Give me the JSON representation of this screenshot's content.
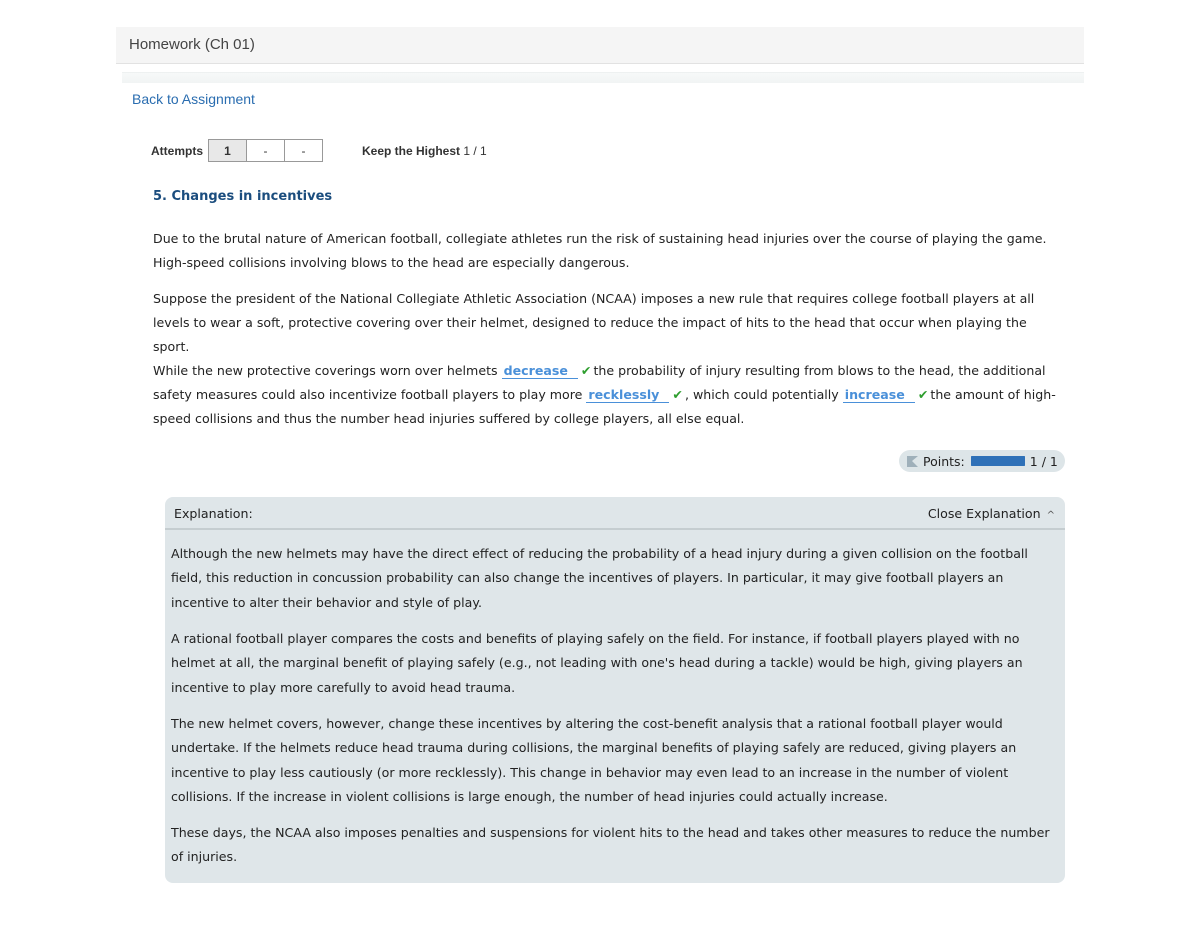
{
  "header": {
    "title": "Homework (Ch 01)"
  },
  "nav": {
    "back_link": "Back to Assignment"
  },
  "attempts": {
    "label": "Attempts",
    "boxes": [
      "1",
      "-",
      "-"
    ],
    "keep_label": "Keep the Highest",
    "keep_value": "1 / 1"
  },
  "question": {
    "title": "5. Changes in incentives",
    "para1": "Due to the brutal nature of American football, collegiate athletes run the risk of sustaining head injuries over the course of playing the game. High-speed collisions involving blows to the head are especially dangerous.",
    "para2": "Suppose the president of the National Collegiate Athletic Association (NCAA) imposes a new rule that requires college football players at all levels to wear a soft, protective covering over their helmet, designed to reduce the impact of hits to the head that occur when playing the sport.",
    "para3": {
      "part1": "While the new protective coverings worn over helmets",
      "blank1": "decrease",
      "part2": "the probability of injury resulting from blows to the head, the additional safety measures could also incentivize football players to play more",
      "blank2": "recklessly",
      "part3": ", which could potentially",
      "blank3": "increase",
      "part4": "the amount of high-speed collisions and thus the number head injuries suffered by college players, all else equal."
    },
    "check_glyph": "✔"
  },
  "points": {
    "label": "Points:",
    "value": "1 / 1",
    "fraction": 1.0
  },
  "explanation": {
    "title": "Explanation:",
    "close_label": "Close Explanation",
    "chevron": "^",
    "paragraphs": [
      "Although the new helmets may have the direct effect of reducing the probability of a head injury during a given collision on the football field, this reduction in concussion probability can also change the incentives of players. In particular, it may give football players an incentive to alter their behavior and style of play.",
      "A rational football player compares the costs and benefits of playing safely on the field. For instance, if football players played with no helmet at all, the marginal benefit of playing safely (e.g., not leading with one's head during a tackle) would be high, giving players an incentive to play more carefully to avoid head trauma.",
      "The new helmet covers, however, change these incentives by altering the cost-benefit analysis that a rational football player would undertake. If the helmets reduce head trauma during collisions, the marginal benefits of playing safely are reduced, giving players an incentive to play less cautiously (or more recklessly). This change in behavior may even lead to an increase in the number of violent collisions. If the increase in violent collisions is large enough, the number of head injuries could actually increase.",
      "These days, the NCAA also imposes penalties and suspensions for violent hits to the head and takes other measures to reduce the number of injuries."
    ]
  }
}
